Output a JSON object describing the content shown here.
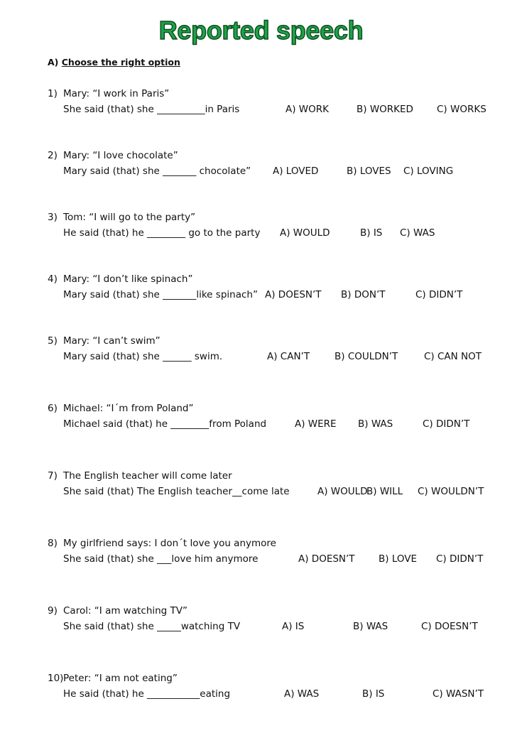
{
  "title": "Reported speech",
  "section": {
    "prefix": "A)",
    "label": "Choose the right option"
  },
  "questions": [
    {
      "num": "1)",
      "prompt": "Mary: “I work in Paris”",
      "sentence": "She said (that) she __________in Paris",
      "options": [
        "A) WORK",
        "B) WORKED",
        "C) WORKS"
      ]
    },
    {
      "num": "2)",
      "prompt": "Mary: “I love chocolate”",
      "sentence": "Mary said (that) she  _______ chocolate”",
      "options": [
        "A) LOVED",
        "B) LOVES",
        "C) LOVING"
      ]
    },
    {
      "num": "3)",
      "prompt": "Tom: “I will go to the party”",
      "sentence": "He said (that) he ________ go to the party",
      "options": [
        "A) WOULD",
        "B) IS",
        "C) WAS"
      ]
    },
    {
      "num": "4)",
      "prompt": "Mary: “I don’t like spinach”",
      "sentence": "Mary said (that) she _______like spinach”",
      "options": [
        "A) DOESN’T",
        "B) DON’T",
        "C) DIDN’T"
      ]
    },
    {
      "num": "5)",
      "prompt": "Mary: “I can’t swim”",
      "sentence": "Mary said (that) she ______ swim.",
      "options": [
        "A) CAN’T",
        "B) COULDN’T",
        "C) CAN NOT"
      ]
    },
    {
      "num": "6)",
      "prompt": "Michael: “I´m from Poland”",
      "sentence": "Michael said (that) he ________from Poland",
      "options": [
        "A) WERE",
        "B) WAS",
        "C) DIDN’T"
      ]
    },
    {
      "num": "7)",
      "prompt": "The English teacher will come later",
      "sentence": "She said (that) The English teacher__come late",
      "options": [
        "A) WOULD",
        "B) WILL",
        "C) WOULDN’T"
      ]
    },
    {
      "num": "8)",
      "prompt": "My girlfriend says: I don´t love you anymore",
      "sentence": "She said (that) she ___love him anymore",
      "options": [
        "A) DOESN’T",
        "B) LOVE",
        "C) DIDN’T"
      ]
    },
    {
      "num": "9)",
      "prompt": "Carol: “I am watching TV”",
      "sentence": "She said (that) she _____watching TV",
      "options": [
        "A) IS",
        "B) WAS",
        "C) DOESN’T"
      ]
    },
    {
      "num": "10)",
      "prompt": "Peter: “I am not eating”",
      "sentence": "He said (that) he  ___________eating",
      "options": [
        "A) WAS",
        "B) IS",
        "C) WASN’T"
      ]
    }
  ]
}
